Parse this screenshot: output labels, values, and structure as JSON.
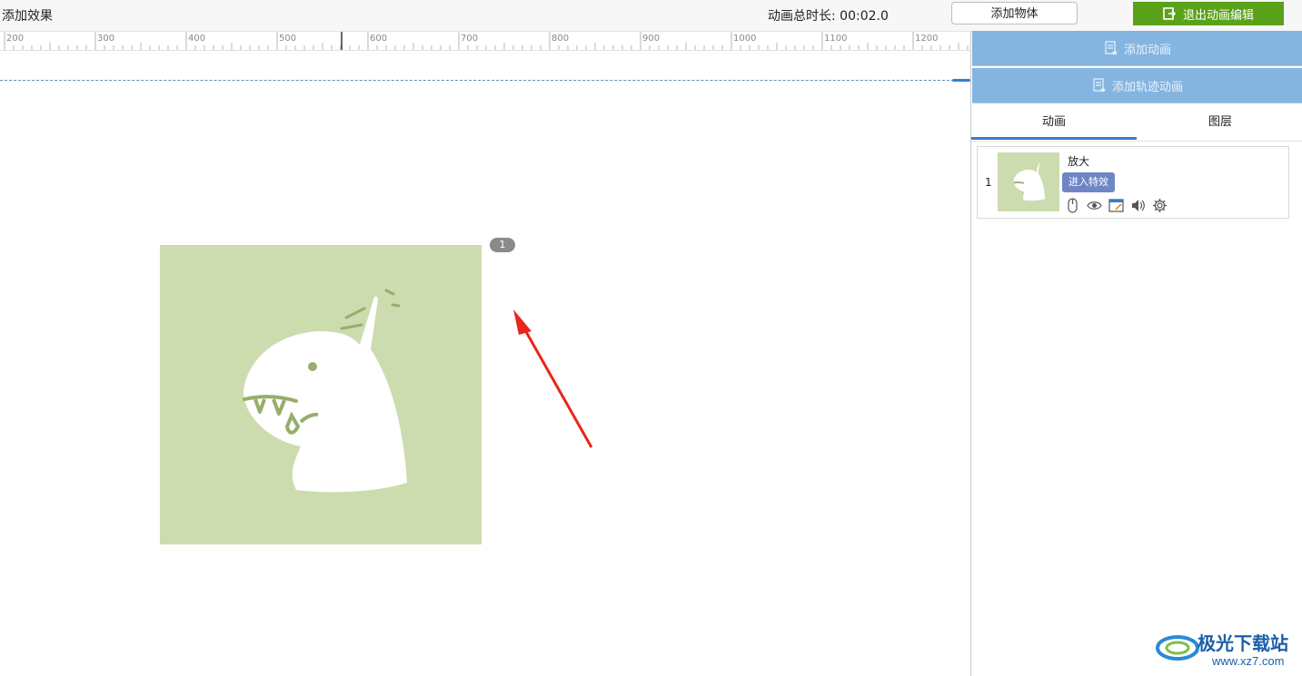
{
  "header": {
    "title": "添加效果",
    "duration_label": "动画总时长: 00:02.0",
    "add_object_label": "添加物体",
    "exit_label": "退出动画编辑"
  },
  "ruler": {
    "labels": [
      "200",
      "300",
      "400",
      "500",
      "600",
      "700",
      "800",
      "900",
      "1000",
      "1100",
      "1200"
    ]
  },
  "canvas": {
    "order_badge": "1"
  },
  "panel": {
    "add_animation_label": "添加动画",
    "add_path_animation_label": "添加轨迹动画",
    "tabs": [
      {
        "label": "动画"
      },
      {
        "label": "图层"
      }
    ],
    "items": [
      {
        "index": "1",
        "name": "放大",
        "tag": "进入特效"
      }
    ]
  },
  "watermark": {
    "brand": "极光下载站",
    "url": "www.xz7.com"
  },
  "colors": {
    "accent_green": "#5aa21a",
    "panel_button": "#84b5e0",
    "tab_active": "#3a7bd5",
    "effect_tag": "#6f86c6",
    "image_bg": "#ccdcae"
  }
}
